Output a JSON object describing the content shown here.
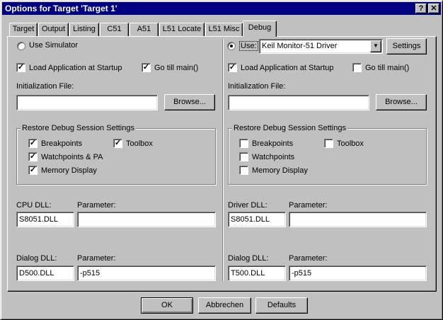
{
  "window": {
    "title": "Options for Target 'Target 1'",
    "help_label": "?",
    "close_label": "✕"
  },
  "tabs": [
    {
      "label": "Target"
    },
    {
      "label": "Output"
    },
    {
      "label": "Listing"
    },
    {
      "label": "C51"
    },
    {
      "label": "A51"
    },
    {
      "label": "L51 Locate"
    },
    {
      "label": "L51 Misc"
    },
    {
      "label": "Debug",
      "active": true
    }
  ],
  "left": {
    "use_simulator_label": "Use Simulator",
    "use_simulator_selected": false,
    "load_app_label": "Load Application at Startup",
    "load_app_checked": true,
    "go_main_label": "Go  till main()",
    "go_main_checked": true,
    "init_file_label": "Initialization File:",
    "init_file_value": "",
    "browse_label": "Browse...",
    "restore_title": "Restore Debug Session Settings",
    "breakpoints_label": "Breakpoints",
    "breakpoints_checked": true,
    "toolbox_label": "Toolbox",
    "toolbox_checked": true,
    "watchpoints_label": "Watchpoints & PA",
    "watchpoints_checked": true,
    "memory_label": "Memory Display",
    "memory_checked": true,
    "cpu_dll_label": "CPU DLL:",
    "cpu_dll_value": "S8051.DLL",
    "cpu_param_label": "Parameter:",
    "cpu_param_value": "",
    "dialog_dll_label": "Dialog DLL:",
    "dialog_dll_value": "D500.DLL",
    "dialog_param_label": "Parameter:",
    "dialog_param_value": "-p515"
  },
  "right": {
    "use_label": "Use:",
    "use_selected": true,
    "driver_value": "Keil Monitor-51 Driver",
    "settings_label": "Settings",
    "load_app_label": "Load Application at Startup",
    "load_app_checked": true,
    "go_main_label": "Go  till main()",
    "go_main_checked": false,
    "init_file_label": "Initialization File:",
    "init_file_value": "",
    "browse_label": "Browse...",
    "restore_title": "Restore Debug Session Settings",
    "breakpoints_label": "Breakpoints",
    "breakpoints_checked": false,
    "toolbox_label": "Toolbox",
    "toolbox_checked": false,
    "watchpoints_label": "Watchpoints",
    "watchpoints_checked": false,
    "memory_label": "Memory Display",
    "memory_checked": false,
    "driver_dll_label": "Driver DLL:",
    "driver_dll_value": "S8051.DLL",
    "driver_param_label": "Parameter:",
    "driver_param_value": "",
    "dialog_dll_label": "Dialog DLL:",
    "dialog_dll_value": "T500.DLL",
    "dialog_param_label": "Parameter:",
    "dialog_param_value": "-p515"
  },
  "footer": {
    "ok_label": "OK",
    "cancel_label": "Abbrechen",
    "defaults_label": "Defaults"
  }
}
